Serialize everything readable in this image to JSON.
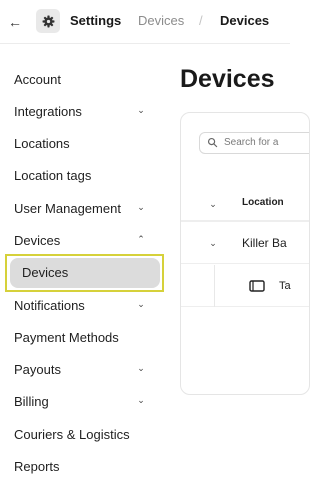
{
  "breadcrumb": {
    "back_icon": "arrow-left-icon",
    "settings_icon": "gear-icon",
    "settings": "Settings",
    "devices": "Devices",
    "separator": "/",
    "current": "Devices"
  },
  "sidebar": {
    "items": [
      {
        "label": "Account",
        "chevron": false
      },
      {
        "label": "Integrations",
        "chevron": "down"
      },
      {
        "label": "Locations",
        "chevron": false
      },
      {
        "label": "Location tags",
        "chevron": false
      },
      {
        "label": "User Management",
        "chevron": "down"
      },
      {
        "label": "Devices",
        "chevron": "up"
      },
      {
        "label": "Devices",
        "chevron": false,
        "active": true
      },
      {
        "label": "Notifications",
        "chevron": "down"
      },
      {
        "label": "Payment Methods",
        "chevron": false
      },
      {
        "label": "Payouts",
        "chevron": "down"
      },
      {
        "label": "Billing",
        "chevron": "down"
      },
      {
        "label": "Couriers & Logistics",
        "chevron": false
      },
      {
        "label": "Reports",
        "chevron": false
      }
    ]
  },
  "main": {
    "title": "Devices",
    "search_placeholder": "Search for a",
    "table": {
      "column_header": "Location",
      "group_row": "Killer Ba",
      "device_row": "Ta"
    }
  },
  "colors": {
    "active_item_bg": "#dcdcdc",
    "highlight_border": "#d6d13a"
  }
}
